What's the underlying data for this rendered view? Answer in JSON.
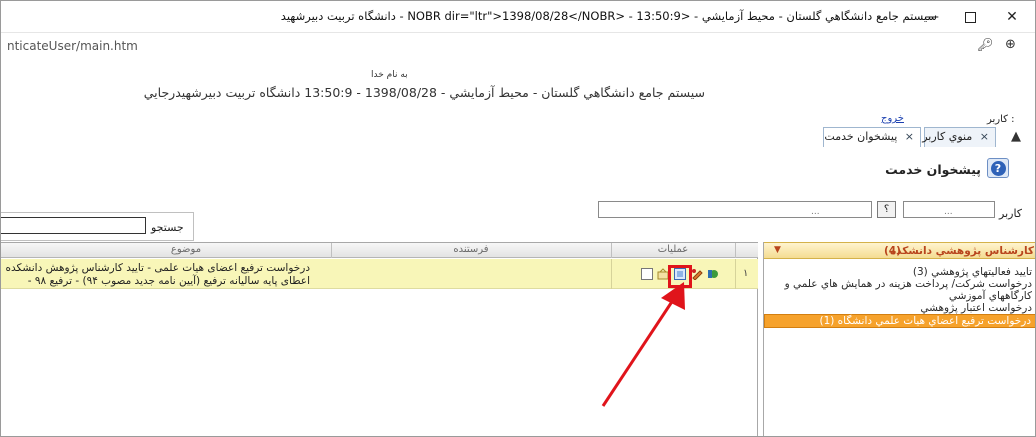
{
  "window": {
    "title": "سيستم جامع دانشگاهي گلستان - محيط آزمايشي - <NOBR dir=\"ltr\">1398/08/28</NOBR> - 13:50:9 - دانشگاه تربیت دبیرشهید",
    "url": "nticateUser/main.htm",
    "controls": {
      "minimize": "—",
      "close": "✕"
    }
  },
  "header": {
    "basmala": "به نام خدا",
    "title": "سيستم جامع دانشگاهي گلستان - محيط آزمايشي - 1398/08/28 - 13:50:9   دانشگاه تربيت دبيرشهيدرجايي",
    "user_label": "کاربر :",
    "logout": "خروج"
  },
  "tabs": [
    {
      "close": "×",
      "label": "منوي کاربر"
    },
    {
      "close": "×",
      "label": "پيشخوان خدمت"
    }
  ],
  "page": {
    "help_glyph": "?",
    "title": "پيشخوان خدمت"
  },
  "filter": {
    "user_label": "کاربر",
    "lookup_glyph": "؟",
    "dots": "..."
  },
  "search": {
    "label": "جستجو",
    "value": ""
  },
  "grid": {
    "columns": {
      "subject": "موضوع",
      "sender": "فرستنده",
      "operations": "عمليات"
    },
    "rows": [
      {
        "num": "١",
        "subject_line1": "درخواست ترفیع اعضای هیات علمی - تایید کارشناس پژوهش دانشکده",
        "subject_line2": "اعطای پایه سالیانه ترفیع (آیین نامه جدید مصوب ۹۴) - ترفیع ۹۸ -",
        "sender": ""
      }
    ]
  },
  "panel": {
    "title": "کارشناس پژوهشي دانشکده",
    "count": "(4)",
    "chevron": "▼",
    "items": [
      {
        "label": "تاييد فعاليتهاي پژوهشي (3)",
        "active": false
      },
      {
        "label": "درخواست شرکت/ پرداخت هزينه در همايش هاي علمي و کارگاههاي آموزشي",
        "active": false
      },
      {
        "label": "درخواست اعتبار پژوهشي",
        "active": false
      },
      {
        "label": "درخواست ترفيع اعضاي هيات علمي دانشگاه (1)",
        "active": true
      }
    ]
  },
  "colors": {
    "row_highlight": "#f8f6b8",
    "panel_header_text": "#b8451d",
    "active_item": "#f6a22c",
    "annotation": "#e0141b"
  },
  "icons": {
    "key": "key-icon",
    "zoom": "zoom-icon",
    "collapse": "chevron-up-icon",
    "row_ops": [
      "new-document-icon",
      "attach-icon",
      "view-icon",
      "edit-icon",
      "forward-icon"
    ]
  }
}
